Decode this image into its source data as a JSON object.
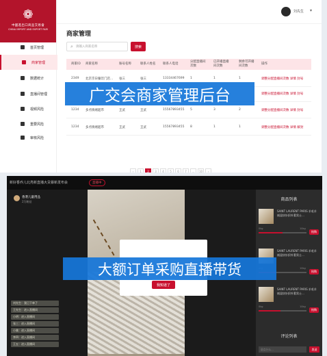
{
  "admin": {
    "logo": {
      "emblem": "❁",
      "name_cn": "中國進出口商品交易會",
      "name_en": "CHINA IMPORT AND EXPORT FAIR"
    },
    "nav": [
      {
        "label": "首页管理",
        "icon": "home-icon",
        "active": false
      },
      {
        "label": "商家管理",
        "icon": "store-icon",
        "active": true
      },
      {
        "label": "数据统计",
        "icon": "bar-chart-icon",
        "active": false
      },
      {
        "label": "直播间管理",
        "icon": "calendar-icon",
        "active": false
      },
      {
        "label": "视频风险",
        "icon": "shield-icon",
        "active": false
      },
      {
        "label": "重要风险",
        "icon": "shield-icon",
        "active": false
      },
      {
        "label": "审核风险",
        "icon": "warning-icon",
        "active": false
      }
    ],
    "user": {
      "name": "刘先生"
    },
    "page_title": "商家管理",
    "search": {
      "placeholder": "请输入商家名称",
      "button": "搜索"
    },
    "table": {
      "headers": [
        "商家ID",
        "商家名称",
        "账号名称",
        "联系人姓名",
        "联系人电话",
        "分配直播间次数",
        "已开播直播间次数",
        "剩余可开播间次数",
        "操作"
      ],
      "rows": [
        [
          "2349",
          "北京京日餐饮门店…",
          "张三",
          "张三",
          "13334467699",
          "1",
          "1",
          "1",
          "调整分配直播间次数  详情  封号"
        ],
        [
          "",
          "",
          "",
          "",
          "",
          "",
          "",
          "",
          "调整分配直播间次数  详情  封号"
        ],
        [
          "1234",
          "多点情绪超市",
          "王武",
          "王武",
          "15567893455",
          "5",
          "3",
          "2",
          "调整分配直播间次数  详情  封号"
        ],
        [
          "1234",
          "多点情绪超市",
          "王武",
          "王武",
          "15567893455",
          "8",
          "1",
          "1",
          "调整分配直播间次数  详情  解封"
        ]
      ]
    },
    "pager": [
      "‹",
      "1",
      "2",
      "3",
      "4",
      "5",
      "6",
      "7",
      "…",
      "10",
      "›"
    ],
    "pager_active": "2",
    "banner": "广交会商家管理后台"
  },
  "live": {
    "title": "新好香乔儿北亮新直播大贷暴新发布会",
    "badge": "直播中",
    "anchor": {
      "name": "香港儿童用品",
      "sub": "2万粉丝"
    },
    "modal_button": "我知道了",
    "banner": "大额订单采购直播带货",
    "chat": [
      "刘先生：我已下单了",
      "王先生：进入直播间",
      "小明：进入直播间",
      "张三：进入直播间",
      "小美：进入直播间",
      "李四：进入直播间",
      "王五：进入直播间"
    ],
    "product_title": "商品列表",
    "products": [
      {
        "name": "SAINT LAURENT PARIS 羊毛羊绒混纺针织外套男士…",
        "low": "0kg",
        "high": "10kg",
        "button": "抢购",
        "progress": 0.5
      },
      {
        "name": "SAINT LAURENT PARIS 羊毛羊绒混纺针织外套男士…",
        "low": "0kg",
        "high": "10kg",
        "button": "抢购",
        "progress": 0.35
      },
      {
        "name": "SAINT LAURENT PARIS 羊毛羊绒混纺针织外套男士…",
        "low": "0kg",
        "high": "10kg",
        "button": "抢购",
        "progress": 0.45
      }
    ],
    "comment_title": "评论列表",
    "comment_placeholder": "说点什么…",
    "comment_send": "发送",
    "colors": {
      "accent": "#c8102e",
      "banner": "#1676d9"
    }
  }
}
